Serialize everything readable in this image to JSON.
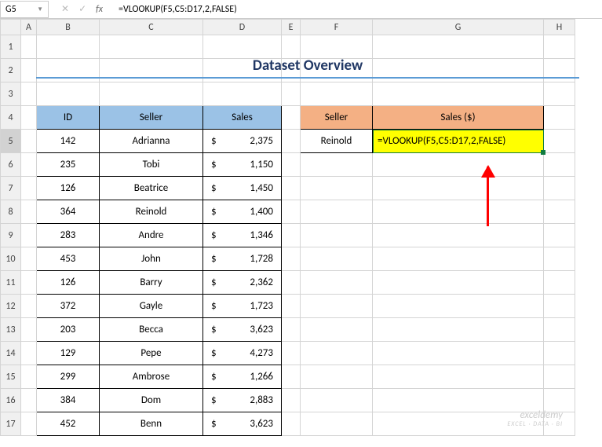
{
  "nameBox": "G5",
  "formulaBar": "=VLOOKUP(F5,C5:D17,2,FALSE)",
  "title": "Dataset Overview",
  "headers": {
    "id": "ID",
    "seller": "Seller",
    "sales": "Sales"
  },
  "lookupHeaders": {
    "seller": "Seller",
    "sales": "Sales ($)"
  },
  "lookupValue": "Reinold",
  "cellFormula": "=VLOOKUP(F5,C5:D17,2,FALSE)",
  "rows": [
    {
      "id": "142",
      "seller": "Adrianna",
      "sales": "2,375"
    },
    {
      "id": "235",
      "seller": "Tobi",
      "sales": "1,150"
    },
    {
      "id": "126",
      "seller": "Beatrice",
      "sales": "1,450"
    },
    {
      "id": "364",
      "seller": "Reinold",
      "sales": "1,400"
    },
    {
      "id": "283",
      "seller": "Andre",
      "sales": "1,346"
    },
    {
      "id": "453",
      "seller": "John",
      "sales": "1,728"
    },
    {
      "id": "126",
      "seller": "Barry",
      "sales": "2,362"
    },
    {
      "id": "372",
      "seller": "Gayle",
      "sales": "1,723"
    },
    {
      "id": "203",
      "seller": "Becca",
      "sales": "3,623"
    },
    {
      "id": "129",
      "seller": "Pepe",
      "sales": "4,273"
    },
    {
      "id": "299",
      "seller": "Ambrose",
      "sales": "1,266"
    },
    {
      "id": "384",
      "seller": "Dom",
      "sales": "2,883"
    },
    {
      "id": "452",
      "seller": "Benn",
      "sales": "3,623"
    }
  ],
  "cols": [
    "A",
    "B",
    "C",
    "D",
    "E",
    "F",
    "G",
    "H"
  ],
  "currency": "$",
  "watermark1": "exceldemy",
  "watermark2": "EXCEL · DATA · BI"
}
